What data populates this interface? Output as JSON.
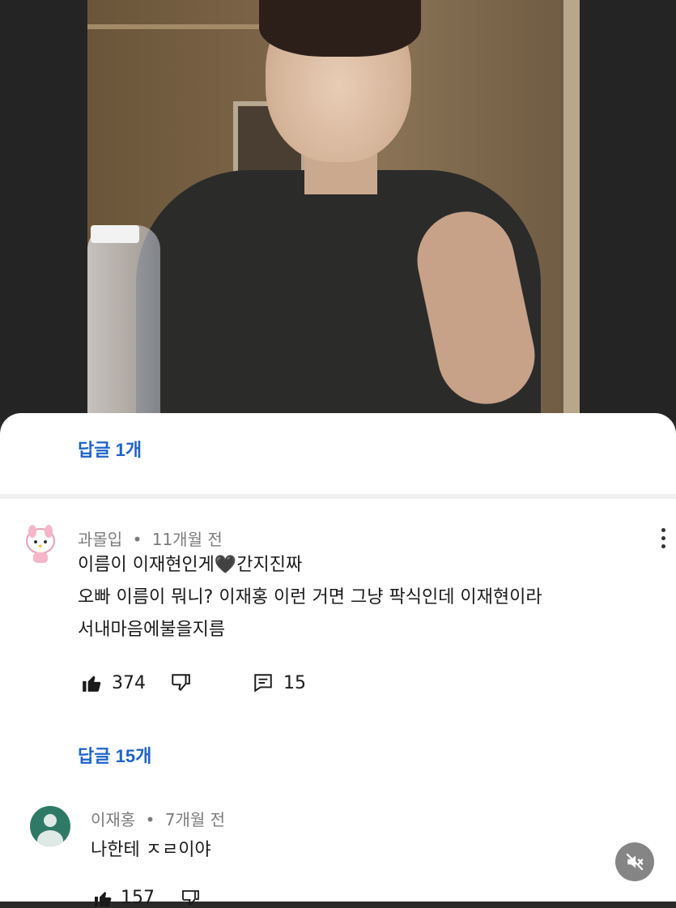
{
  "replies_top": {
    "label": "답글 1개"
  },
  "comment1": {
    "author": "과몰입",
    "separator": "•",
    "time": "11개월 전",
    "lines": [
      "이름이 이재현인게🖤간지진짜",
      "오빠 이름이 뭐니? 이재홍 이런 거면 그냥 팍식인데 이재현이라",
      "서내마음에불을지름"
    ],
    "likes": "374",
    "replies_count": "15",
    "replies_link": "답글 15개"
  },
  "comment2": {
    "author": "이재홍",
    "separator": "•",
    "time": "7개월 전",
    "text": "나한테 ㅈㄹ이야",
    "likes": "157"
  },
  "colors": {
    "link_blue": "#1f63c9",
    "meta_gray": "#7b7b7b",
    "avatar_green": "#2f7a67"
  },
  "icons": [
    "like-icon",
    "dislike-icon",
    "reply-icon",
    "more-vert-icon",
    "mute-icon"
  ]
}
